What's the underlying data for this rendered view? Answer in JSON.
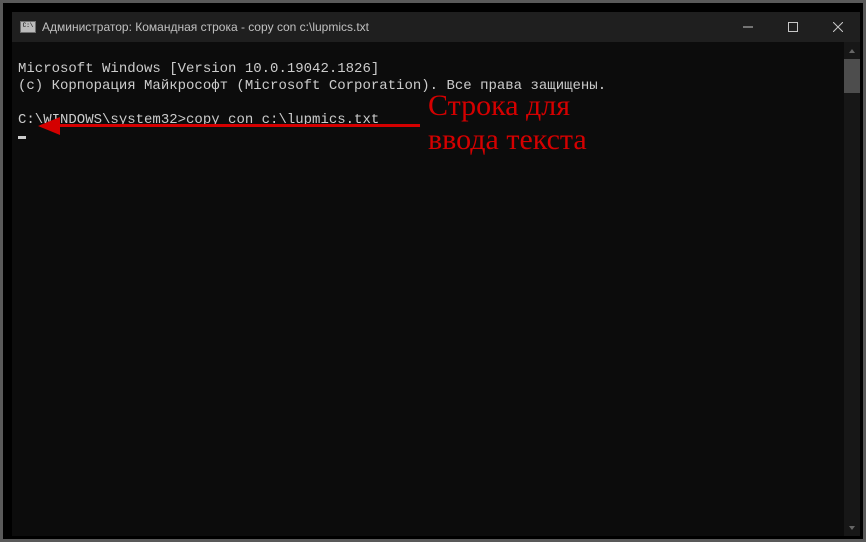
{
  "window": {
    "title": "Администратор: Командная строка - copy  con c:\\lupmics.txt"
  },
  "terminal": {
    "line1": "Microsoft Windows [Version 10.0.19042.1826]",
    "line2": "(c) Корпорация Майкрософт (Microsoft Corporation). Все права защищены.",
    "blank": "",
    "prompt": "C:\\WINDOWS\\system32>",
    "command": "copy con c:\\lupmics.txt"
  },
  "annotation": {
    "line1": "Строка для",
    "line2": "ввода текста"
  },
  "colors": {
    "accent_red": "#d40000",
    "terminal_bg": "#0c0c0c",
    "terminal_fg": "#cccccc",
    "titlebar_bg": "#1f1f1f"
  }
}
